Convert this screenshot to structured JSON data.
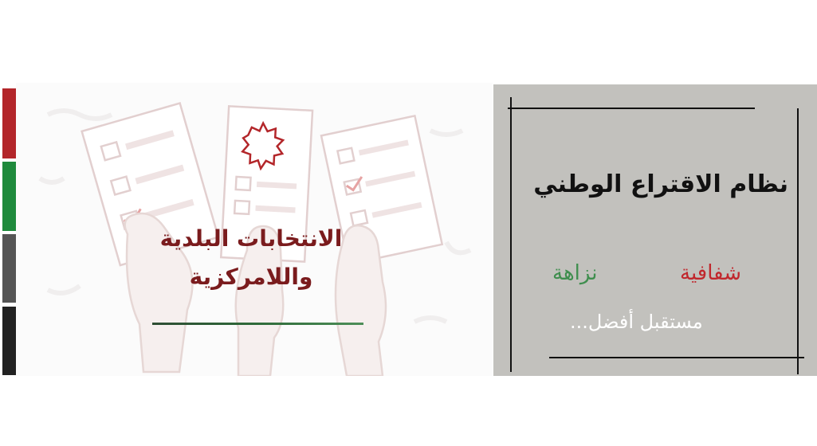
{
  "flag_colors": {
    "red": "#c1272d",
    "green": "#1f8a3c",
    "grey": "#555555",
    "black": "#222222"
  },
  "left_section": {
    "title_line_1": "الانتخابات البلدية",
    "title_line_2": "واللامركزية",
    "title_color": "#7a1b1d",
    "underline_color": "#2f6b3a",
    "illustration_icons": [
      "ballot-paper-icon",
      "jordan-star-icon",
      "raised-hand-icon",
      "checkmark-icon"
    ]
  },
  "right_section": {
    "title": "نظام الاقتراع الوطني",
    "word_transparency": "شفافية",
    "word_integrity": "نزاهة",
    "slogan": "مستقبل أفضل...",
    "panel_color": "#c2c1bd",
    "red_color": "#c1272d",
    "green_color": "#3f8e4e"
  }
}
